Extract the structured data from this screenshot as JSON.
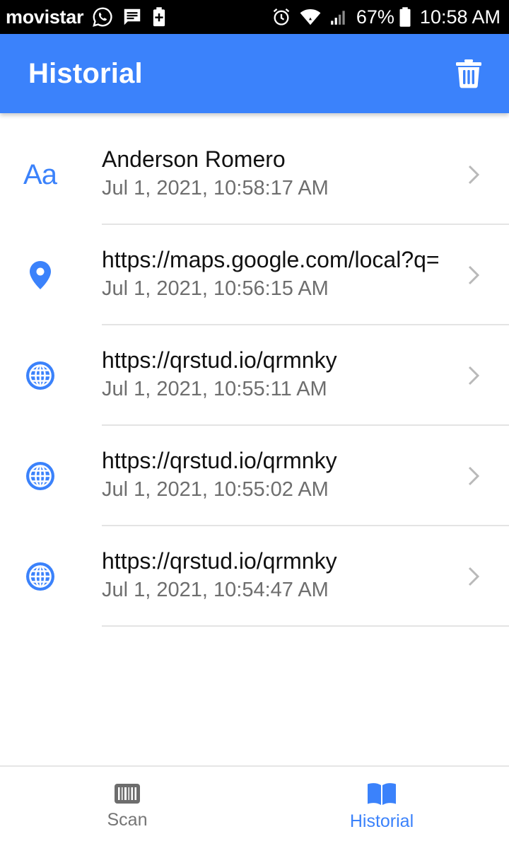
{
  "status_bar": {
    "carrier": "movistar",
    "battery_percent": "67%",
    "time": "10:58 AM",
    "left_icons": [
      "whatsapp-icon",
      "message-icon",
      "battery-plus-icon"
    ],
    "right_icons": [
      "alarm-icon",
      "wifi-icon",
      "signal-icon",
      "battery-icon"
    ]
  },
  "app_bar": {
    "title": "Historial",
    "action_icon": "trash-icon"
  },
  "history": [
    {
      "type": "text",
      "icon": "text-icon",
      "title": "Anderson Romero",
      "date": "Jul 1, 2021, 10:58:17 AM"
    },
    {
      "type": "location",
      "icon": "location-pin-icon",
      "title": "https://maps.google.com/local?q=",
      "date": "Jul 1, 2021, 10:56:15 AM"
    },
    {
      "type": "url",
      "icon": "globe-icon",
      "title": "https://qrstud.io/qrmnky",
      "date": "Jul 1, 2021, 10:55:11 AM"
    },
    {
      "type": "url",
      "icon": "globe-icon",
      "title": "https://qrstud.io/qrmnky",
      "date": "Jul 1, 2021, 10:55:02 AM"
    },
    {
      "type": "url",
      "icon": "globe-icon",
      "title": "https://qrstud.io/qrmnky",
      "date": "Jul 1, 2021, 10:54:47 AM"
    }
  ],
  "text_icon_glyph": "Aa",
  "bottom_nav": [
    {
      "label": "Scan",
      "icon": "barcode-icon",
      "active": false
    },
    {
      "label": "Historial",
      "icon": "book-icon",
      "active": true
    }
  ],
  "colors": {
    "primary": "#3b82fb",
    "status_bar": "#000000",
    "text_primary": "#111111",
    "text_secondary": "#6e6e6e",
    "inactive_nav": "#757575",
    "divider": "#e4e4e4"
  }
}
